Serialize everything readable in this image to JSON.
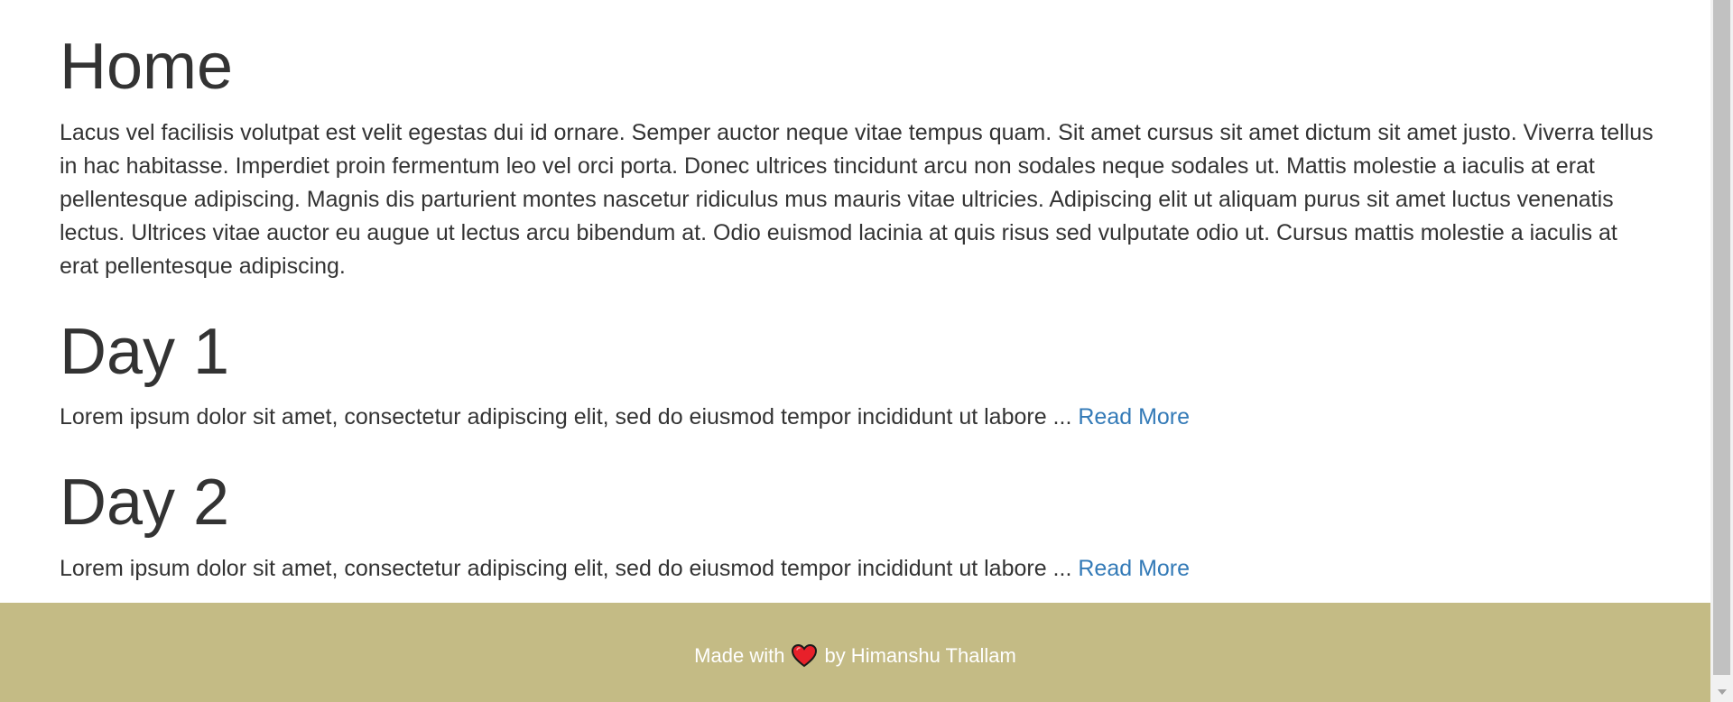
{
  "sections": {
    "home": {
      "title": "Home",
      "text": "Lacus vel facilisis volutpat est velit egestas dui id ornare. Semper auctor neque vitae tempus quam. Sit amet cursus sit amet dictum sit amet justo. Viverra tellus in hac habitasse. Imperdiet proin fermentum leo vel orci porta. Donec ultrices tincidunt arcu non sodales neque sodales ut. Mattis molestie a iaculis at erat pellentesque adipiscing. Magnis dis parturient montes nascetur ridiculus mus mauris vitae ultricies. Adipiscing elit ut aliquam purus sit amet luctus venenatis lectus. Ultrices vitae auctor eu augue ut lectus arcu bibendum at. Odio euismod lacinia at quis risus sed vulputate odio ut. Cursus mattis molestie a iaculis at erat pellentesque adipiscing."
    },
    "day1": {
      "title": "Day 1",
      "excerpt": "Lorem ipsum dolor sit amet, consectetur adipiscing elit, sed do eiusmod tempor incididunt ut labore ... ",
      "read_more": "Read More"
    },
    "day2": {
      "title": "Day 2",
      "excerpt": "Lorem ipsum dolor sit amet, consectetur adipiscing elit, sed do eiusmod tempor incididunt ut labore ... ",
      "read_more": "Read More"
    }
  },
  "footer": {
    "prefix": "Made with",
    "icon": "heart-icon",
    "suffix": "by Himanshu Thallam"
  },
  "colors": {
    "text": "#333333",
    "link": "#337ab7",
    "footer_bg": "#c4bb85",
    "footer_text": "#ffffff",
    "heart": "#e8202a"
  }
}
